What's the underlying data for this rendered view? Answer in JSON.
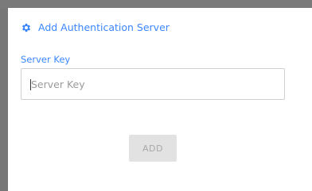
{
  "dialog": {
    "title": "Add Authentication Server",
    "icon": "gear-icon",
    "accent_color": "#3b86ff",
    "field": {
      "label": "Server Key",
      "value": "",
      "placeholder": "Server Key"
    },
    "add_button_label": "ADD"
  }
}
